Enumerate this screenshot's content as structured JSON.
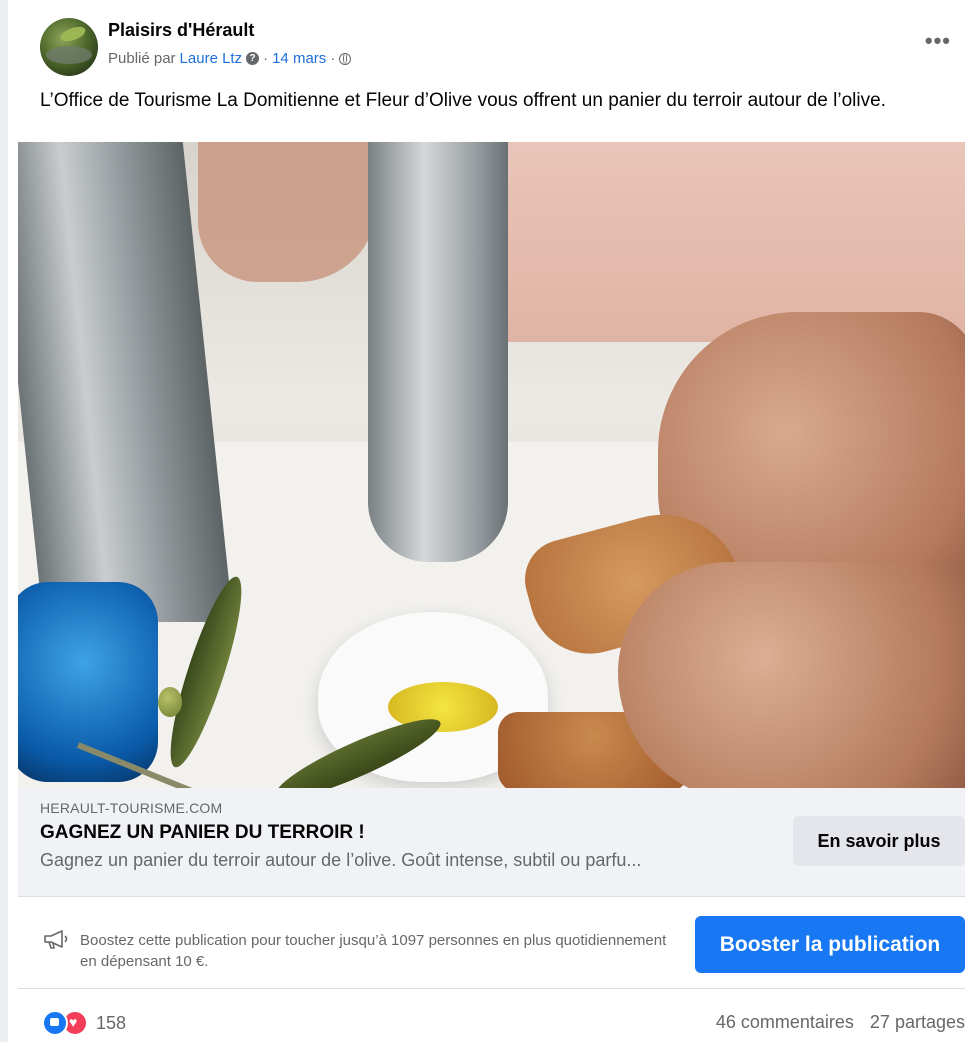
{
  "post": {
    "page_name": "Plaisirs d'Hérault",
    "published_by_prefix": "Publié par",
    "author": "Laure Ltz",
    "date": "14 mars",
    "separator": "·",
    "text": "L’Office de Tourisme La Domitienne et Fleur d’Olive vous offrent un panier du terroir autour de l’olive.",
    "more_label": "•••"
  },
  "link_preview": {
    "domain": "HERAULT-TOURISME.COM",
    "headline": "GAGNEZ UN PANIER DU TERROIR !",
    "description": "Gagnez un panier du terroir autour de l’olive. Goût intense, subtil ou parfu...",
    "cta_label": "En savoir plus"
  },
  "boost": {
    "text": "Boostez cette publication pour toucher jusqu’à 1097 personnes en plus quotidiennement en dépensant 10 €.",
    "button_label": "Booster la publication"
  },
  "footer": {
    "reaction_count": "158",
    "comments": "46 commentaires",
    "shares": "27 partages"
  },
  "colors": {
    "accent": "#1877f2",
    "link": "#216fdb",
    "love": "#f33e58"
  }
}
